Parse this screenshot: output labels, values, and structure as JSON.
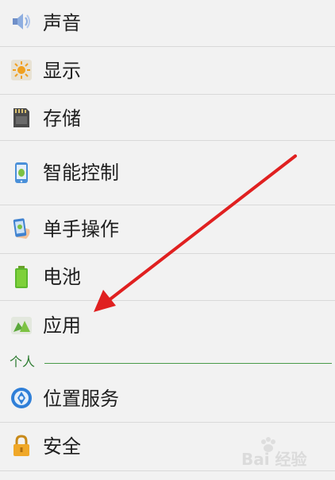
{
  "settings": {
    "items": [
      {
        "label": "声音",
        "icon": "speaker-icon"
      },
      {
        "label": "显示",
        "icon": "brightness-icon"
      },
      {
        "label": "存储",
        "icon": "sd-card-icon"
      },
      {
        "label": "智能控制",
        "icon": "phone-android-icon"
      },
      {
        "label": "单手操作",
        "icon": "hand-phone-icon"
      },
      {
        "label": "电池",
        "icon": "battery-icon"
      },
      {
        "label": "应用",
        "icon": "apps-icon"
      }
    ],
    "section": {
      "label": "个人"
    },
    "personal_items": [
      {
        "label": "位置服务",
        "icon": "location-icon"
      },
      {
        "label": "安全",
        "icon": "lock-icon"
      }
    ]
  },
  "colors": {
    "accent": "#2e7d32",
    "arrow": "#e02020",
    "background": "#f2f2f2"
  },
  "watermark": {
    "text": "Bai 经验"
  }
}
